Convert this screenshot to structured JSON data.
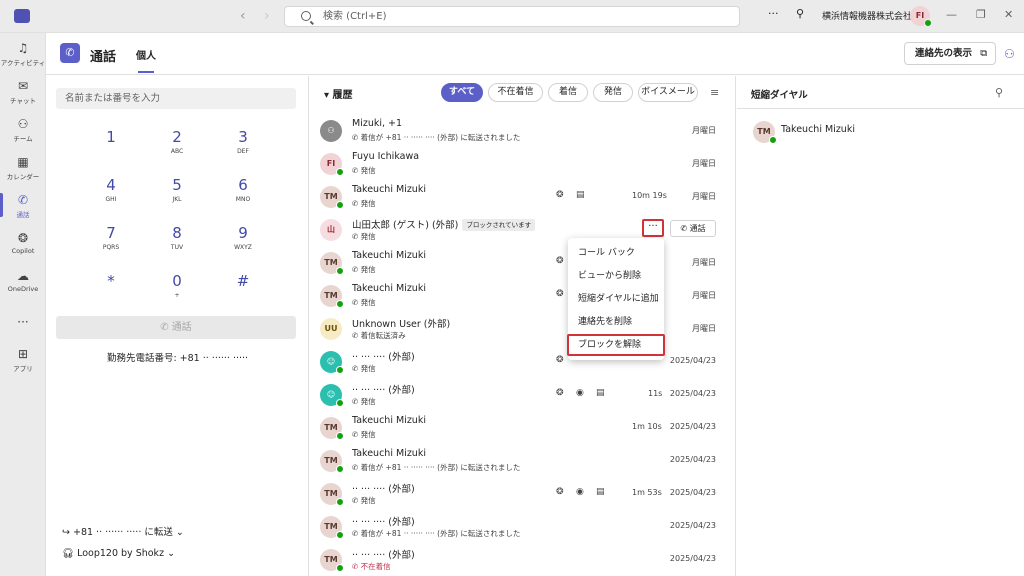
{
  "app": {
    "search_placeholder": "検索 (Ctrl+E)",
    "org_name": "横浜情報機器株式会社",
    "avatar_initials": "FI",
    "more": "···",
    "nav_back": "‹",
    "nav_forward": "›"
  },
  "rail": [
    {
      "label": "アクティビティ",
      "icon": "bell-icon",
      "glyph": "♫"
    },
    {
      "label": "チャット",
      "icon": "chat-icon",
      "glyph": "✉"
    },
    {
      "label": "チーム",
      "icon": "teams-icon",
      "glyph": "⚇"
    },
    {
      "label": "カレンダー",
      "icon": "calendar-icon",
      "glyph": "▦"
    },
    {
      "label": "通話",
      "icon": "phone-icon",
      "glyph": "✆"
    },
    {
      "label": "Copilot",
      "icon": "copilot-icon",
      "glyph": "❂"
    },
    {
      "label": "OneDrive",
      "icon": "cloud-icon",
      "glyph": "☁"
    },
    {
      "label": "",
      "icon": "more-icon",
      "glyph": "···"
    },
    {
      "label": "アプリ",
      "icon": "apps-icon",
      "glyph": "⊞"
    }
  ],
  "header": {
    "title": "通話",
    "tab": "個人",
    "contacts_button": "連絡先の表示"
  },
  "dialpad": {
    "placeholder": "名前または番号を入力",
    "keys": [
      {
        "digit": "1",
        "letters": ""
      },
      {
        "digit": "2",
        "letters": "ABC"
      },
      {
        "digit": "3",
        "letters": "DEF"
      },
      {
        "digit": "4",
        "letters": "GHI"
      },
      {
        "digit": "5",
        "letters": "JKL"
      },
      {
        "digit": "6",
        "letters": "MNO"
      },
      {
        "digit": "7",
        "letters": "PQRS"
      },
      {
        "digit": "8",
        "letters": "TUV"
      },
      {
        "digit": "9",
        "letters": "WXYZ"
      },
      {
        "digit": "*",
        "letters": ""
      },
      {
        "digit": "0",
        "letters": "+"
      },
      {
        "digit": "#",
        "letters": ""
      }
    ],
    "call_button": "通話",
    "work_number": "勤務先電話番号: +81 ·· ······ ·····",
    "forward": "+81 ·· ······ ····· に転送",
    "device": "Loop120 by Shokz"
  },
  "history": {
    "title": "履歴",
    "filters": [
      "すべて",
      "不在着信",
      "着信",
      "発信",
      "ボイスメール"
    ],
    "rows": [
      {
        "name": "Mizuki, +1",
        "sub": "着信が +81 ·· ····· ···· (外部) に転送されました",
        "date": "月曜日",
        "initials": "",
        "dur": ""
      },
      {
        "name": "Fuyu Ichikawa",
        "sub": "発信",
        "date": "月曜日",
        "initials": "FI",
        "dur": ""
      },
      {
        "name": "Takeuchi Mizuki",
        "sub": "発信",
        "date": "月曜日",
        "initials": "TM",
        "dur": "10m 19s"
      },
      {
        "name": "山田太郎 (ゲスト) (外部)",
        "sub": "発信",
        "date": "",
        "initials": "山",
        "dur": "",
        "badge": "ブロックされています"
      },
      {
        "name": "Takeuchi Mizuki",
        "sub": "発信",
        "date": "月曜日",
        "initials": "TM",
        "dur": ""
      },
      {
        "name": "Takeuchi Mizuki",
        "sub": "発信",
        "date": "月曜日",
        "initials": "TM",
        "dur": ""
      },
      {
        "name": "Unknown User (外部)",
        "sub": "着信転送済み",
        "date": "月曜日",
        "initials": "UU",
        "dur": ""
      },
      {
        "name": "·· ··· ···· (外部)",
        "sub": "発信",
        "date": "2025/04/23",
        "initials": "",
        "dur": ""
      },
      {
        "name": "·· ··· ···· (外部)",
        "sub": "発信",
        "date": "2025/04/23",
        "initials": "",
        "dur": "11s"
      },
      {
        "name": "Takeuchi Mizuki",
        "sub": "発信",
        "date": "2025/04/23",
        "initials": "TM",
        "dur": "1m 10s"
      },
      {
        "name": "Takeuchi Mizuki",
        "sub": "着信が +81 ·· ····· ···· (外部) に転送されました",
        "date": "2025/04/23",
        "initials": "TM",
        "dur": ""
      },
      {
        "name": "·· ··· ···· (外部)",
        "sub": "発信",
        "date": "2025/04/23",
        "initials": "TM",
        "dur": "1m 53s"
      },
      {
        "name": "·· ··· ···· (外部)",
        "sub": "着信が +81 ·· ····· ···· (外部) に転送されました",
        "date": "2025/04/23",
        "initials": "TM",
        "dur": ""
      },
      {
        "name": "·· ··· ···· (外部)",
        "sub": "不在着信",
        "date": "2025/04/23",
        "initials": "TM",
        "dur": ""
      }
    ],
    "row_call_label": "通話"
  },
  "menu": {
    "items": [
      "コール バック",
      "ビューから削除",
      "短縮ダイヤルに追加",
      "連絡先を削除",
      "ブロックを解除"
    ]
  },
  "speed_dial": {
    "title": "短縮ダイヤル",
    "contact": {
      "initials": "TM",
      "name": "Takeuchi Mizuki"
    }
  }
}
